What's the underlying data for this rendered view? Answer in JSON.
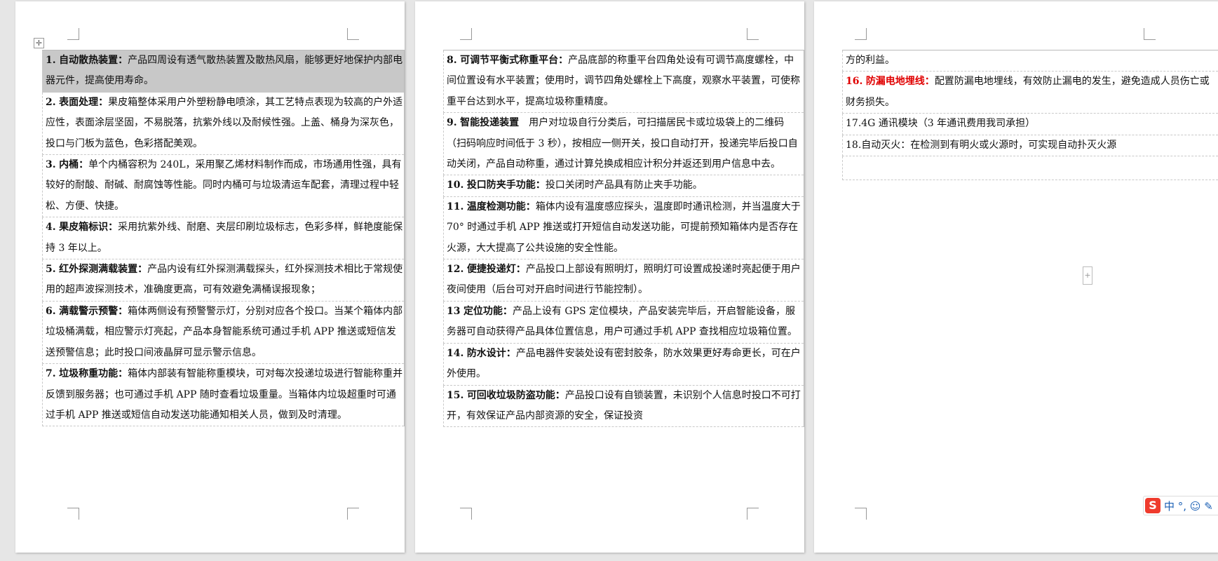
{
  "page1": {
    "rows": [
      {
        "num": "1.",
        "title": "自动散热装置：",
        "text": "产品四周设有透气散热装置及散热风扇，能够更好地保护内部电器元件，提高使用寿命。",
        "highlight": true
      },
      {
        "num": "2.",
        "title": "表面处理：",
        "text": "果皮箱整体采用户外塑粉静电喷涂，其工艺特点表现为较高的户外适应性，表面涂层坚固，不易脱落，抗紫外线以及耐候性强。上盖、桶身为深灰色，投口与门板为蓝色，色彩搭配美观。"
      },
      {
        "num": "3.",
        "title": "内桶：",
        "text": "单个内桶容积为 240L，采用聚乙烯材料制作而成，市场通用性强，具有较好的耐酸、耐碱、耐腐蚀等性能。同时内桶可与垃圾清运车配套，清理过程中轻松、方便、快捷。"
      },
      {
        "num": "4.",
        "title": "果皮箱标识：",
        "text": "采用抗紫外线、耐磨、夹层印刷垃圾标志，色彩多样，鲜艳度能保持 3 年以上。"
      },
      {
        "num": "5.",
        "title": "红外探测满载装置：",
        "text": "产品内设有红外探测满载探头，红外探测技术相比于常规使用的超声波探测技术，准确度更高，可有效避免满桶误报现象；"
      },
      {
        "num": "6.",
        "title": "满载警示预警：",
        "text": "箱体两侧设有预警警示灯，分别对应各个投口。当某个箱体内部垃圾桶满载，相应警示灯亮起，产品本身智能系统可通过手机 APP 推送或短信发送预警信息；此时投口间液晶屏可显示警示信息。"
      },
      {
        "num": "7.",
        "title": "垃圾称重功能：",
        "text": "箱体内部装有智能称重模块，可对每次投递垃圾进行智能称重并反馈到服务器；也可通过手机 APP 随时查看垃圾重量。当箱体内垃圾超重时可通过手机 APP 推送或短信自动发送功能通知相关人员，做到及时清理。"
      }
    ]
  },
  "page2": {
    "rows": [
      {
        "num": "8.",
        "title": "可调节平衡式称重平台：",
        "text": "产品底部的称重平台四角处设有可调节高度螺栓，中间位置设有水平装置；使用时，调节四角处螺栓上下高度，观察水平装置，可使称重平台达到水平，提高垃圾称重精度。"
      },
      {
        "num": "9.",
        "title": "智能投递装置",
        "text": "　用户对垃圾自行分类后，可扫描居民卡或垃圾袋上的二维码（扫码响应时间低于 3 秒），按相应一侧开关，投口自动打开，投递完毕后投口自动关闭，产品自动称重，通过计算兑换成相应计积分并返还到用户信息中去。"
      },
      {
        "num": "10.",
        "title": "投口防夹手功能：",
        "text": "投口关闭时产品具有防止夹手功能。"
      },
      {
        "num": "11.",
        "title": "温度检测功能：",
        "text": "箱体内设有温度感应探头，温度即时通讯检测，并当温度大于 70° 时通过手机 APP 推送或打开短信自动发送功能，可提前预知箱体内是否存在火源，大大提高了公共设施的安全性能。"
      },
      {
        "num": "12.",
        "title": "便捷投递灯：",
        "text": "产品投口上部设有照明灯，照明灯可设置成投递时亮起便于用户夜间使用（后台可对开启时间进行节能控制）。"
      },
      {
        "num": "13",
        "title": "定位功能：",
        "text": "产品上设有 GPS 定位模块，产品安装完毕后，开启智能设备，服务器可自动获得产品具体位置信息，用户可通过手机 APP 查找相应垃圾箱位置。"
      },
      {
        "num": "14.",
        "title": "防水设计：",
        "text": "产品电器件安装处设有密封胶条，防水效果更好寿命更长，可在户外使用。"
      },
      {
        "num": "15.",
        "title": "可回收垃圾防盗功能：",
        "text": "产品投口设有自锁装置，未识别个人信息时投口不可打开，有效保证产品内部资源的安全，保证投资"
      }
    ]
  },
  "page3": {
    "rows": [
      {
        "text": "方的利益。"
      },
      {
        "num": "16.",
        "title": "防漏电地埋线：",
        "text": "配置防漏电地埋线，有效防止漏电的发生，避免造成人员伤亡或财务损失。",
        "red": true
      },
      {
        "text": "17.4G 通讯模块（3 年通讯费用我司承担）"
      },
      {
        "text": "18.自动灭火：在检测到有明火或火源时，可实现自动扑灭火源"
      },
      {
        "text": ""
      }
    ]
  },
  "ui": {
    "table_move_handle": "✛",
    "expand_handle": "+",
    "ime_logo": "S",
    "ime_text": "中 °, ☺ ✎"
  }
}
